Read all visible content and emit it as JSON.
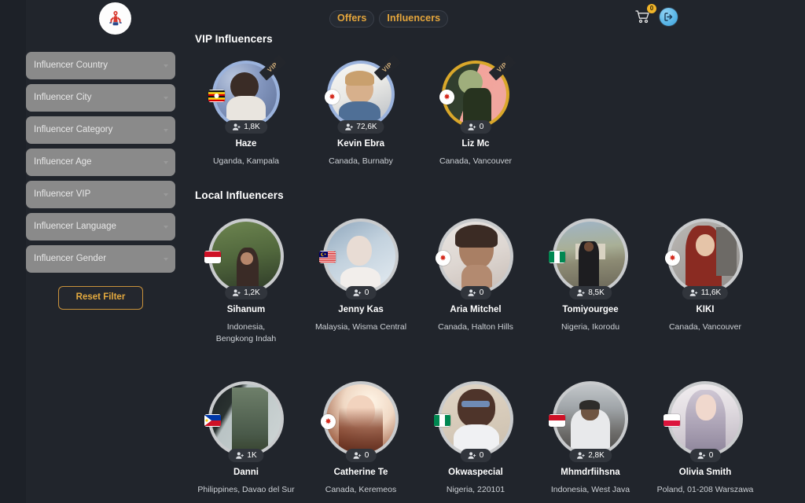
{
  "app": {
    "logo_alt": "app-logo",
    "background_color": "#21252c",
    "accent_color": "#e5a63c",
    "sidebar_color": "#1d2128"
  },
  "header": {
    "tabs": [
      {
        "label": "Offers",
        "active": true
      },
      {
        "label": "Influencers",
        "active": true
      }
    ],
    "cart": {
      "icon": "shopping-cart-icon",
      "badge_count": "0"
    },
    "login": {
      "icon": "login-icon"
    }
  },
  "sidebar": {
    "filters": [
      {
        "placeholder": "Influencer Country",
        "value": ""
      },
      {
        "placeholder": "Influencer City",
        "value": ""
      },
      {
        "placeholder": "Influencer Category",
        "value": ""
      },
      {
        "placeholder": "Influencer Age",
        "value": ""
      },
      {
        "placeholder": "Influencer VIP",
        "value": ""
      },
      {
        "placeholder": "Influencer Language",
        "value": ""
      },
      {
        "placeholder": "Influencer Gender",
        "value": ""
      }
    ],
    "reset_button": "Reset Filter"
  },
  "sections": {
    "vip_title": "VIP Influencers",
    "local_title": "Local Influencers"
  },
  "vip_influencers": [
    {
      "name": "Haze",
      "location": "Uganda, Kampala",
      "followers": "1,8K",
      "vip_badge": "VIP",
      "ring_color": "#9bb3dd",
      "flag": "uganda",
      "photo_top": "#7e94c4",
      "photo_bottom": "#cdd3dd"
    },
    {
      "name": "Kevin Ebra",
      "location": "Canada,  Burnaby",
      "followers": "72,6K",
      "vip_badge": "VIP",
      "ring_color": "#9bb3dd",
      "flag": "canada",
      "photo_top": "#eff0ee",
      "photo_bottom": "#b9bcc2"
    },
    {
      "name": "Liz Mc",
      "location": "Canada,  Vancouver",
      "followers": "0",
      "vip_badge": "VIP",
      "ring_color": "#d9a72a",
      "flag": "canada",
      "photo_top": "#f0a29a",
      "photo_bottom": "#2d3a2c"
    }
  ],
  "local_influencers": [
    {
      "name": "Sihanum",
      "location": "Indonesia,\nBengkong Indah",
      "followers": "1,2K",
      "flag": "indonesia",
      "photo_top": "#5d7244",
      "photo_bottom": "#3a4a33"
    },
    {
      "name": "Jenny Kas",
      "location": "Malaysia,  Wisma Central",
      "followers": "0",
      "flag": "malaysia",
      "photo_top": "#9fb4c9",
      "photo_bottom": "#cfd9e2"
    },
    {
      "name": "Aria Mitchel",
      "location": "Canada,  Halton Hills",
      "followers": "0",
      "flag": "canada",
      "photo_top": "#e3dedb",
      "photo_bottom": "#8d6a58"
    },
    {
      "name": "Tomiyourgee",
      "location": "Nigeria,  Ikorodu",
      "followers": "8,5K",
      "flag": "nigeria",
      "photo_top": "#9aa78e",
      "photo_bottom": "#5c5a4e"
    },
    {
      "name": "KIKI",
      "location": "Canada, Vancouver",
      "followers": "11,6K",
      "flag": "canada",
      "photo_top": "#c9c5c1",
      "photo_bottom": "#7e3127"
    },
    {
      "name": "Danni",
      "location": "Philippines,  Davao del Sur",
      "followers": "1K",
      "flag": "philippines",
      "photo_top": "#cfd6da",
      "photo_bottom": "#4a5a4c"
    },
    {
      "name": "Catherine Te",
      "location": "Canada,  Keremeos",
      "followers": "0",
      "flag": "canada",
      "photo_top": "#f3ded0",
      "photo_bottom": "#7b4a3a"
    },
    {
      "name": "Okwaspecial",
      "location": "Nigeria,  220101",
      "followers": "0",
      "flag": "nigeria",
      "photo_top": "#ded3c4",
      "photo_bottom": "#e8e8ea"
    },
    {
      "name": "Mhmdrfiihsna",
      "location": "Indonesia,  West Java",
      "followers": "2,8K",
      "flag": "indonesia",
      "photo_top": "#b9bec2",
      "photo_bottom": "#6b6a68"
    },
    {
      "name": "Olivia Smith",
      "location": "Poland,  01-208 Warszawa",
      "followers": "0",
      "flag": "poland",
      "photo_top": "#e7e2e4",
      "photo_bottom": "#9b93a2"
    }
  ]
}
